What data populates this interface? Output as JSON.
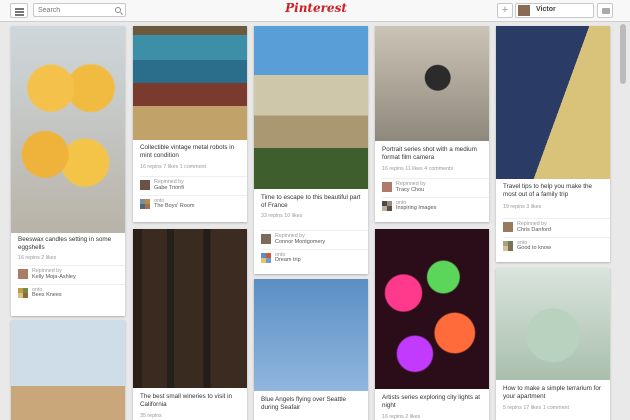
{
  "header": {
    "search_placeholder": "Search",
    "logo": "Pinterest",
    "user_name": "Victor",
    "add_label": "+"
  },
  "pins": [
    {
      "image": "candles-in-eggshells",
      "description": "Beeswax candles setting in some eggshells",
      "stats": "16 repins   2 likes",
      "repinned_by_label": "Repinned by",
      "repinned_by": "Kelly Moja-Ashley",
      "onto_label": "onto",
      "board": "Bees Knees"
    },
    {
      "image": "vintage-robots",
      "description": "Collectible vintage metal robots in mint condition",
      "stats": "16 repins   7 likes   1 comment",
      "repinned_by_label": "Repinned by",
      "repinned_by": "Gabe Trionfi",
      "onto_label": "onto",
      "board": "The Boys' Room"
    },
    {
      "image": "hilltop-village",
      "description": "Time to escape to this beautiful part of France",
      "stats": "33 repins   10 likes",
      "repinned_by_label": "Repinned by",
      "repinned_by": "Connor Montgomery",
      "onto_label": "onto",
      "board": "Dream trip"
    },
    {
      "image": "film-camera",
      "description": "Portrait series shot with a medium format film camera",
      "stats": "16 repins   11 likes   4 comments",
      "repinned_by_label": "Repinned by",
      "repinned_by": "Tracy Chou",
      "onto_label": "onto",
      "board": "Inspiring Images"
    },
    {
      "image": "passport",
      "description": "Travel tips to help you make the most out of a family trip",
      "stats": "19 repins   3 likes",
      "repinned_by_label": "Repinned by",
      "repinned_by": "Chris Danford",
      "onto_label": "onto",
      "board": "Good to know"
    },
    {
      "image": "wine-bottles",
      "description": "The best small wineries to visit in California",
      "stats": "35 repins"
    },
    {
      "image": "blue-angels-jets",
      "description": "Blue Angels flying over Seattle during Seafair"
    },
    {
      "image": "bokeh-lights",
      "description": "Artists series exploring city lights at night",
      "stats": "16 repins   2 likes"
    },
    {
      "image": "glass-terrarium",
      "description": "How to make a simple terrarium for your apartment",
      "stats": "5 repins   17 likes   1 comment"
    },
    {
      "image": "party-decor"
    }
  ]
}
